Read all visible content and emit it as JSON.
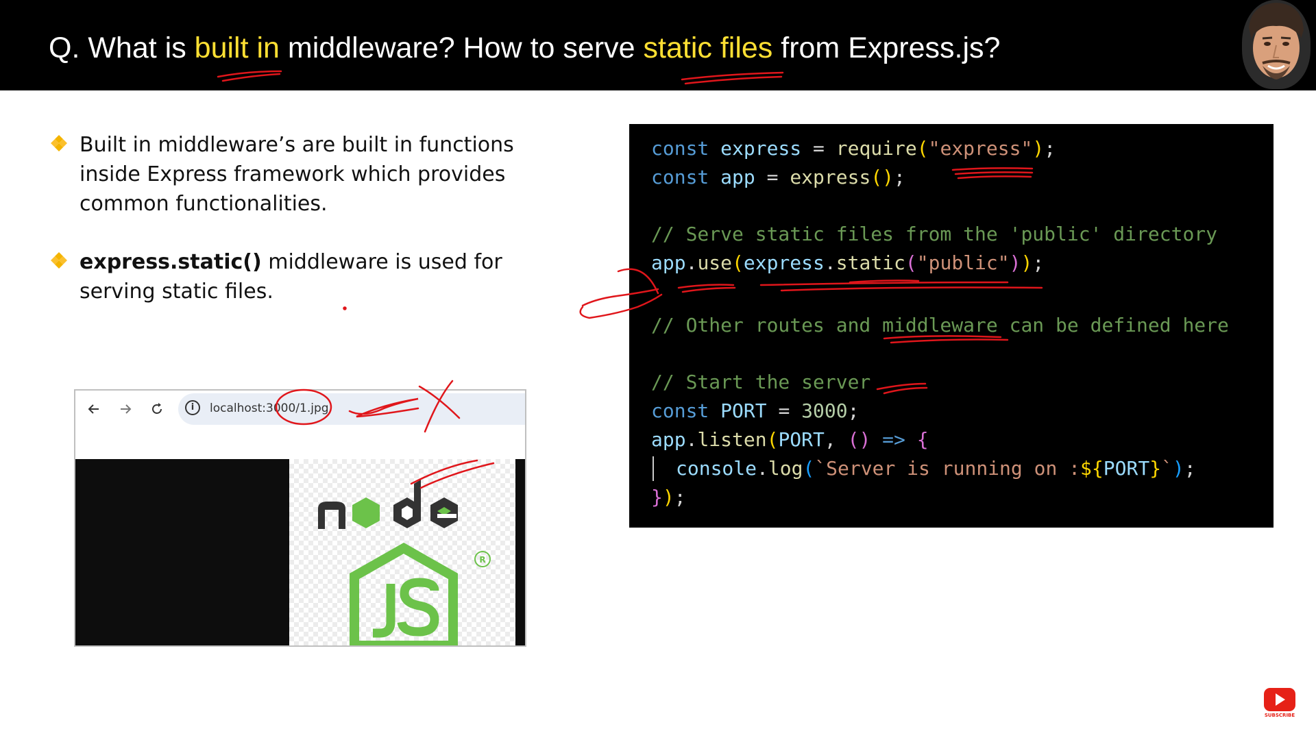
{
  "header": {
    "title_part1": "Q. What is ",
    "title_hl1": "built in",
    "title_part2": " middleware? How to serve ",
    "title_hl2": "static files",
    "title_part3": " from Express.js?"
  },
  "bullets": [
    {
      "bold": "",
      "text": "Built in middleware’s are built in functions inside Express framework which provides common functionalities."
    },
    {
      "bold": "express.static()",
      "text": " middleware is used for serving static files."
    }
  ],
  "browser": {
    "url": "localhost:3000/1.jpg",
    "back_icon": "arrow-left-icon",
    "forward_icon": "arrow-right-icon",
    "reload_icon": "reload-icon",
    "info_icon": "info-icon",
    "image_text": "node"
  },
  "code": {
    "l1_kw": "const",
    "l1_var": " express",
    "l1_op": " = ",
    "l1_fn": "require",
    "l1_open": "(",
    "l1_str": "\"express\"",
    "l1_close": ")",
    "l1_end": ";",
    "l2_kw": "const",
    "l2_var": " app",
    "l2_op": " = ",
    "l2_fn": "express",
    "l2_par": "()",
    "l2_end": ";",
    "l3_cm": "// Serve static files from the 'public' directory",
    "l4_var": "app",
    "l4_dot1": ".",
    "l4_fn1": "use",
    "l4_open1": "(",
    "l4_var2": "express",
    "l4_dot2": ".",
    "l4_fn2": "static",
    "l4_open2": "(",
    "l4_str": "\"public\"",
    "l4_close2": ")",
    "l4_close1": ")",
    "l4_end": ";",
    "l5_cm": "// Other routes and middleware can be defined here",
    "l6_cm": "// Start the server",
    "l7_kw": "const",
    "l7_var": " PORT",
    "l7_op": " = ",
    "l7_num": "3000",
    "l7_end": ";",
    "l8_var": "app",
    "l8_dot": ".",
    "l8_fn": "listen",
    "l8_open": "(",
    "l8_var2": "PORT",
    "l8_comma": ", ",
    "l8_par": "()",
    "l8_arrow": " => ",
    "l8_brace": "{",
    "l9_var": "console",
    "l9_dot": ".",
    "l9_fn": "log",
    "l9_open": "(",
    "l9_tpl1": "`Server is running on :",
    "l9_interp": "${",
    "l9_var2": "PORT",
    "l9_interp_end": "}",
    "l9_tpl2": "`",
    "l9_close": ")",
    "l9_end": ";",
    "l10_brace": "}",
    "l10_close": ")",
    "l10_end": ";"
  },
  "subscribe": {
    "label": "SUBSCRIBE",
    "icon": "youtube-play-icon"
  },
  "colors": {
    "header_bg": "#000000",
    "highlight": "#ffe033",
    "annotation": "#e0161b",
    "node_green": "#6cc24a",
    "node_dark": "#333333"
  }
}
